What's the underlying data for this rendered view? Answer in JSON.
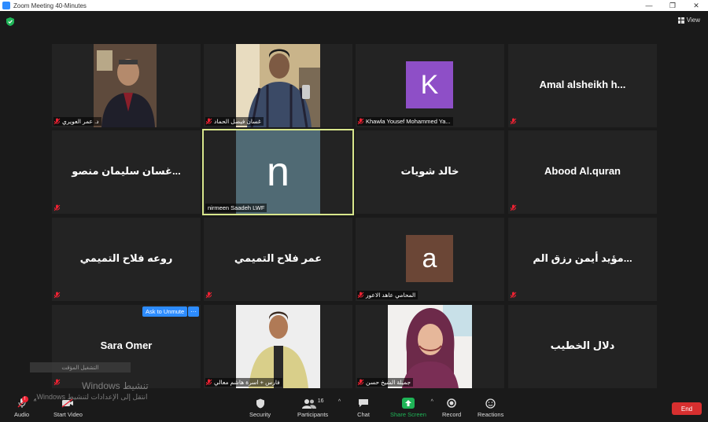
{
  "window": {
    "title": "Zoom Meeting 40-Minutes"
  },
  "topbar": {
    "view_label": "View"
  },
  "tiles": [
    {
      "label": "د. عمر العويري"
    },
    {
      "label": "غسان فيصل الحماد"
    },
    {
      "avatar_letter": "K",
      "avatar_color": "#8e4fc7",
      "label": "Khawla Yousef Mohammed Ya..."
    },
    {
      "name": "Amal alsheikh h...",
      "label": ""
    },
    {
      "name": "غسان سليمان منصو...",
      "label": ""
    },
    {
      "avatar_letter": "n",
      "label": "nirmeen Saadeh LWF"
    },
    {
      "name": "خالد شويات",
      "label": ""
    },
    {
      "name": "Abood Al.quran",
      "label": ""
    },
    {
      "name": "روعه فلاح التميمي",
      "label": ""
    },
    {
      "name": "عمر فلاح التميمي",
      "label": ""
    },
    {
      "avatar_letter": "a",
      "avatar_color": "#6b4636",
      "label": "المحامي عاهد الاعور"
    },
    {
      "name": "مؤيد أيمن رزق الم...",
      "label": ""
    },
    {
      "name": "Sara Omer",
      "label": ""
    },
    {
      "label": "فارس + اسرة هاشم معالي"
    },
    {
      "label": "جميلة الشيخ حسن"
    },
    {
      "name": "دلال الخطيب",
      "label": ""
    }
  ],
  "ask_to_unmute": "Ask to Unmute",
  "ask_more": "···",
  "hover_box": "التشغيل المؤقت",
  "watermark": {
    "line1": "تنشيط Windows",
    "line2": "انتقل إلى الإعدادات لتنشيط Windows."
  },
  "toolbar": {
    "audio": "Audio",
    "start_video": "Start Video",
    "security": "Security",
    "participants": "Participants",
    "participants_count": "16",
    "chat": "Chat",
    "share_screen": "Share Screen",
    "record": "Record",
    "reactions": "Reactions",
    "end": "End"
  },
  "colors": {
    "accent": "#2d8cff",
    "active_border": "#d8e68c",
    "end": "#d72f2f",
    "share": "#1fb457"
  }
}
